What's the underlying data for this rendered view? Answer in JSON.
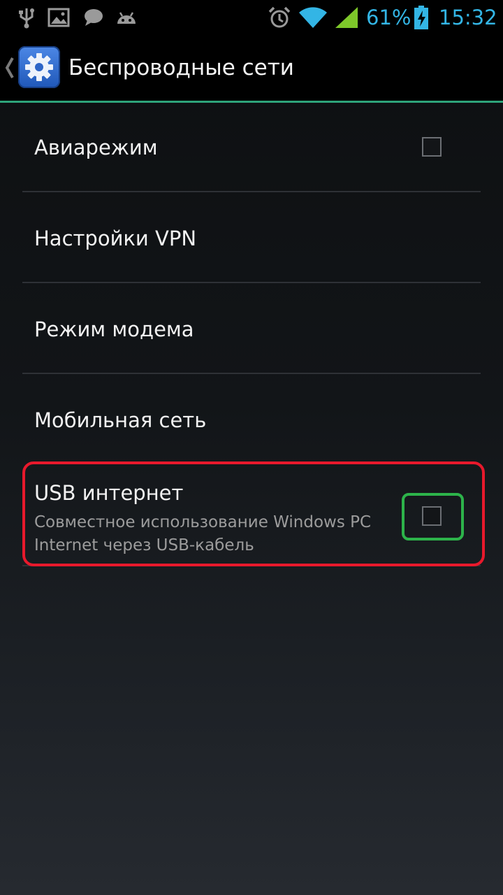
{
  "status_bar": {
    "battery_percent": "61%",
    "time": "15:32",
    "icons": [
      "usb-icon",
      "image-icon",
      "chat-bubble-icon",
      "android-icon",
      "alarm-icon",
      "wifi-icon",
      "signal-icon",
      "battery-charging-icon"
    ]
  },
  "action_bar": {
    "title": "Беспроводные сети",
    "icon": "settings-gear-icon"
  },
  "list": {
    "airplane": {
      "label": "Авиарежим",
      "checked": false
    },
    "vpn": {
      "label": "Настройки VPN"
    },
    "modem": {
      "label": "Режим модема"
    },
    "mobile": {
      "label": "Мобильная сеть"
    },
    "usb": {
      "label": "USB интернет",
      "summary": "Совместное использование Windows PC Internet через USB-кабель",
      "checked": false
    }
  },
  "colors": {
    "accent": "#33b5e5",
    "action_bar_divider": "#2ea37a",
    "highlight_red": "#e8192c",
    "highlight_green": "#2db34a"
  }
}
